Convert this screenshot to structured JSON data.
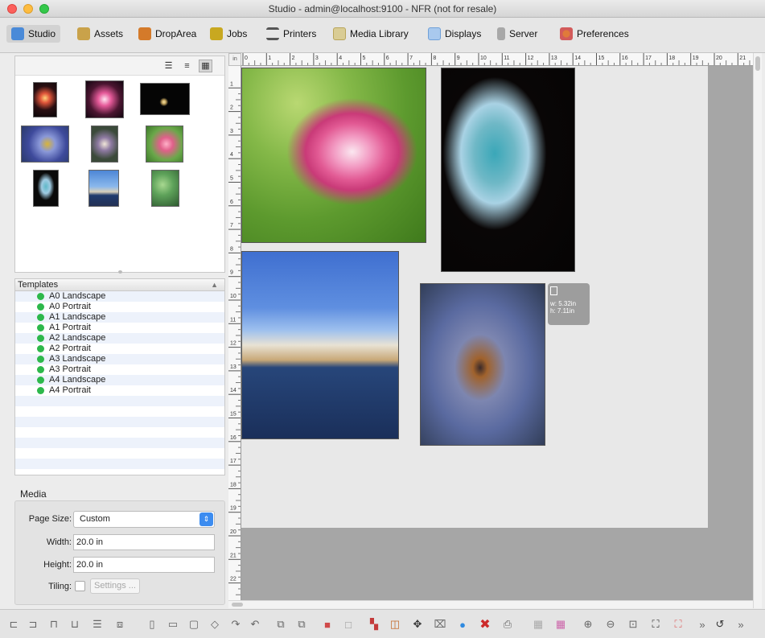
{
  "window": {
    "title": "Studio - admin@localhost:9100 - NFR (not for resale)"
  },
  "tabs": [
    {
      "label": "Studio",
      "icon": "studio-icon",
      "color": "#4a8ad8"
    },
    {
      "label": "Assets",
      "icon": "assets-icon",
      "color": "#c9a24a"
    },
    {
      "label": "DropArea",
      "icon": "droparea-icon",
      "color": "#d47a2a"
    },
    {
      "label": "Jobs",
      "icon": "jobs-icon",
      "color": "#c8a820"
    },
    {
      "label": "Printers",
      "icon": "printer-icon",
      "color": "#555555"
    },
    {
      "label": "Media Library",
      "icon": "media-library-icon",
      "color": "#b9a55a"
    },
    {
      "label": "Displays",
      "icon": "display-icon",
      "color": "#6fa0d8"
    },
    {
      "label": "Server",
      "icon": "server-icon",
      "color": "#888888"
    },
    {
      "label": "Preferences",
      "icon": "preferences-icon",
      "color": "#d25a5a"
    }
  ],
  "templates": {
    "header": "Templates",
    "items": [
      "A0 Landscape",
      "A0 Portrait",
      "A1 Landscape",
      "A1 Portrait",
      "A2 Landscape",
      "A2 Portrait",
      "A3 Landscape",
      "A3 Portrait",
      "A4 Landscape",
      "A4 Portrait"
    ]
  },
  "media": {
    "title": "Media",
    "page_size_label": "Page Size:",
    "page_size_value": "Custom",
    "width_label": "Width:",
    "width_value": "20.0 in",
    "height_label": "Height:",
    "height_value": "20.0 in",
    "tiling_label": "Tiling:",
    "settings_label": "Settings ..."
  },
  "ruler": {
    "corner": "in",
    "h_ticks": [
      "0",
      "1",
      "2",
      "3",
      "4",
      "5",
      "6",
      "7",
      "8",
      "9",
      "10",
      "11",
      "12",
      "13",
      "14",
      "15",
      "16",
      "17",
      "18",
      "19",
      "20",
      "21"
    ],
    "v_ticks": [
      "1",
      "2",
      "3",
      "4",
      "5",
      "6",
      "7",
      "8",
      "9",
      "10",
      "11",
      "12",
      "13",
      "14",
      "15",
      "16",
      "17",
      "18",
      "19",
      "20",
      "21",
      "22",
      "23"
    ]
  },
  "selection_info": {
    "width": "w: 5.32in",
    "height": "h: 7.11in"
  }
}
